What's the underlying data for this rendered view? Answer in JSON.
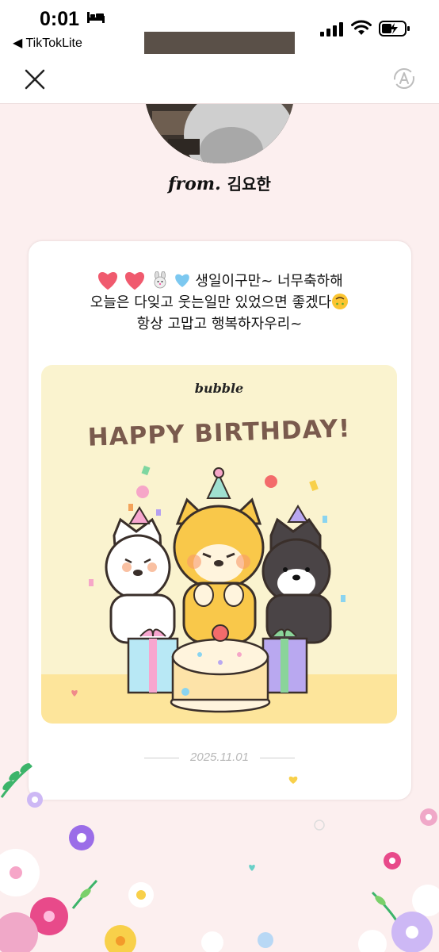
{
  "status_bar": {
    "time": "0:01",
    "back_app": "◀ TikTokLite"
  },
  "nav": {
    "close_icon": "close-icon",
    "translate_icon": "translate-icon"
  },
  "sender": {
    "from_label": "from.",
    "name": "김요한"
  },
  "message": {
    "line1_text": "생일이구만~ 너무축하해",
    "line2_text": "오늘은 다잊고 웃는일만 있었으면 좋겠다",
    "line3_text": "항상 고맙고 행복하자우리~"
  },
  "birthday_card": {
    "brand": "bubble",
    "headline": "HAPPY BIRTHDAY!"
  },
  "date": "2025.11.01",
  "colors": {
    "background": "#fcefef",
    "card_yellow": "#faf3cf",
    "headline_brown": "#7a5a4d"
  }
}
